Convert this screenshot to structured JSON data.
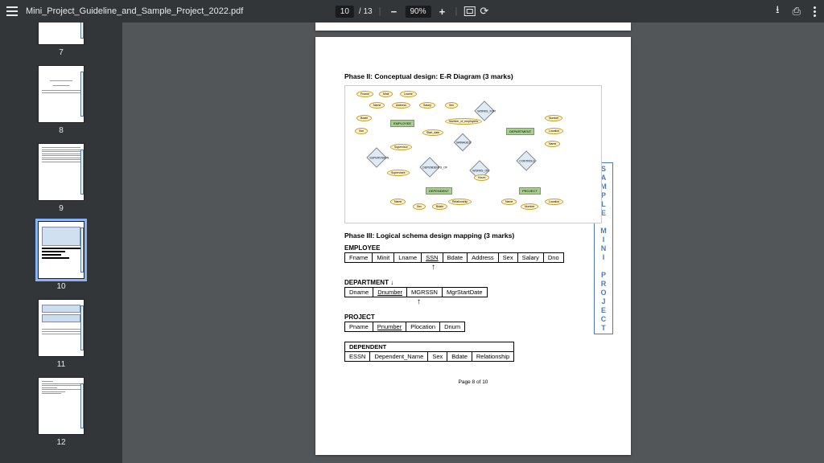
{
  "toolbar": {
    "filename": "Mini_Project_Guideline_and_Sample_Project_2022.pdf",
    "current_page": "10",
    "total_pages": "/ 13",
    "zoom": "90%"
  },
  "thumbnails": [
    {
      "num": "7"
    },
    {
      "num": "8"
    },
    {
      "num": "9"
    },
    {
      "num": "10"
    },
    {
      "num": "11"
    },
    {
      "num": "12"
    }
  ],
  "page": {
    "phase2_title": "Phase II: Conceptual design: E-R Diagram (3 marks)",
    "er": {
      "entities": {
        "employee": "EMPLOYEE",
        "department": "DEPARTMENT",
        "project": "PROJECT",
        "dependent": "DEPENDENT"
      },
      "relationships": {
        "works_for": "WORKS_FOR",
        "manages": "MANAGES",
        "supervision": "SUPERVISION",
        "works_on": "WORKS_ON",
        "controls": "CONTROLS",
        "dependents_of": "DEPENDENTS_OF"
      },
      "attrs": {
        "fname": "Fname",
        "minit": "Minit",
        "lname": "Lname",
        "name": "Name",
        "address": "Address",
        "salary": "Salary",
        "sex": "Sex",
        "bdate": "Bdate",
        "ssn": "Ssn",
        "number_emp": "Number_of_employees",
        "start_date": "Start_date",
        "dname": "Name",
        "dnumber": "Number",
        "location": "Location",
        "pname": "Name",
        "pnumber": "Number",
        "plocation": "Location",
        "hours": "Hours",
        "relationship": "Relationship",
        "supervisor": "Supervisor",
        "supervisee": "Supervisee"
      }
    },
    "phase3_title": "Phase III: Logical schema design mapping (3 marks)",
    "schemas": {
      "employee": {
        "name": "EMPLOYEE",
        "cols": [
          "Fname",
          "Minit",
          "Lname",
          "SSN",
          "Bdate",
          "Address",
          "Sex",
          "Salary",
          "Dno"
        ]
      },
      "department": {
        "name": "DEPARTMENT",
        "cols": [
          "Dname",
          "Dnumber",
          "MGRSSN",
          "MgrStartDate"
        ]
      },
      "project": {
        "name": "PROJECT",
        "cols": [
          "Pname",
          "Pnumber",
          "Plocation",
          "Dnum"
        ]
      },
      "dependent": {
        "name": "DEPENDENT",
        "cols": [
          "ESSN",
          "Dependent_Name",
          "Sex",
          "Bdate",
          "Relationship"
        ]
      }
    },
    "footer": "Page 8 of 10",
    "watermark": "SAMPLE MINI PROJECT"
  }
}
